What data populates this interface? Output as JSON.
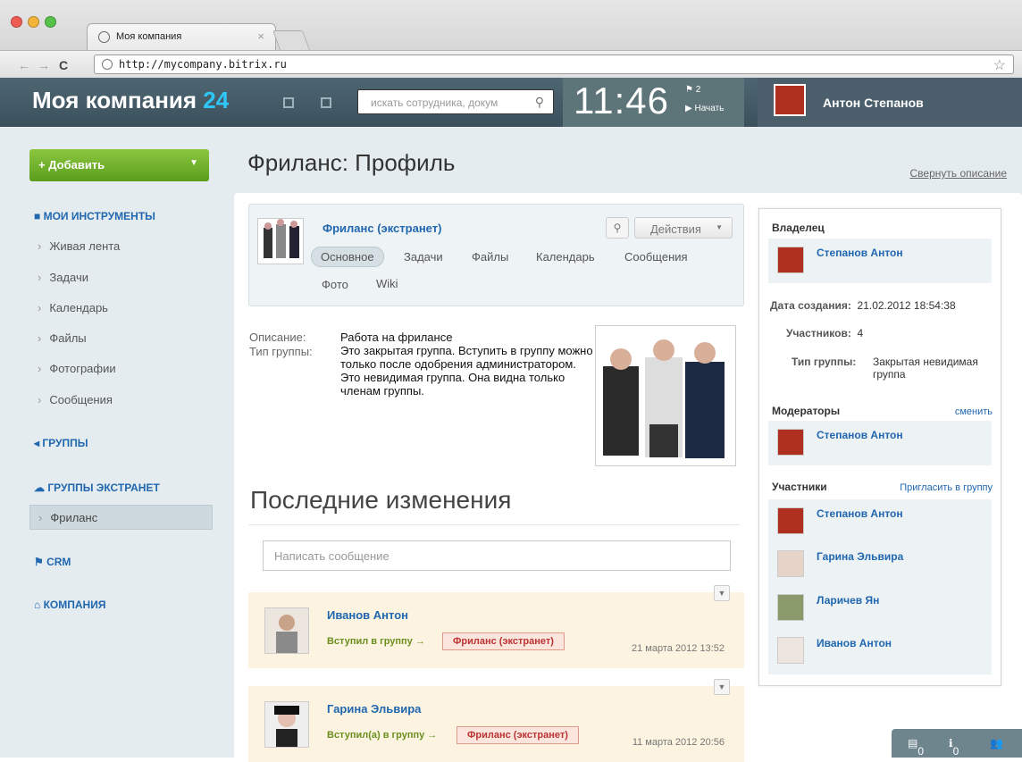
{
  "browser": {
    "tab_title": "Моя компания",
    "url": "http://mycompany.bitrix.ru"
  },
  "header": {
    "logo_text": "Моя компания",
    "logo_number": "24",
    "search_placeholder": "искать сотрудника, докум",
    "clock": "11:46",
    "flag_count": "2",
    "start_label": "Начать",
    "user_name": "Антон Степанов"
  },
  "left": {
    "add_button": "+ Добавить",
    "tools_title": "МОИ ИНСТРУМЕНТЫ",
    "tools": [
      "Живая лента",
      "Задачи",
      "Календарь",
      "Файлы",
      "Фотографии",
      "Сообщения"
    ],
    "groups": "ГРУППЫ",
    "extranet": "ГРУППЫ ЭКСТРАНЕТ",
    "extranet_item": "Фриланс",
    "crm": "CRM",
    "company": "КОМПАНИЯ"
  },
  "main": {
    "page_title": "Фриланс: Профиль",
    "collapse_link": "Свернуть описание",
    "group_name": "Фриланс (экстранет)",
    "actions_label": "Действия",
    "tabs": [
      "Основное",
      "Задачи",
      "Файлы",
      "Календарь",
      "Сообщения",
      "Фото",
      "Wiki"
    ],
    "desc_label": "Описание:",
    "type_label": "Тип группы:",
    "desc_line1": "Работа на фрилансе",
    "desc_line2": "Это закрытая группа. Вступить в группу можно только после одобрения администратором.",
    "desc_line3": "Это невидимая группа. Она видна только членам группы.",
    "recent_title": "Последние изменения",
    "message_placeholder": "Написать сообщение",
    "feed": [
      {
        "name": "Иванов Антон",
        "action": "Вступил в группу →",
        "group": "Фриланс (экстранет)",
        "date": "21 марта 2012 13:52"
      },
      {
        "name": "Гарина Эльвира",
        "action": "Вступил(а) в группу →",
        "group": "Фриланс (экстранет)",
        "date": "11 марта 2012 20:56"
      }
    ]
  },
  "side": {
    "owner_title": "Владелец",
    "owner_name": "Степанов Антон",
    "created_label": "Дата создания:",
    "created_value": "21.02.2012 18:54:38",
    "members_label": "Участников:",
    "members_value": "4",
    "type_label": "Тип группы:",
    "type_value": "Закрытая невидимая группа",
    "moderators_title": "Модераторы",
    "change_link": "сменить",
    "moderator_name": "Степанов Антон",
    "participants_title": "Участники",
    "invite_link": "Пригласить в группу",
    "participants": [
      "Степанов Антон",
      "Гарина Эльвира",
      "Ларичев Ян",
      "Иванов Антон"
    ]
  },
  "corner": {
    "messages": "0",
    "notices": "0"
  }
}
